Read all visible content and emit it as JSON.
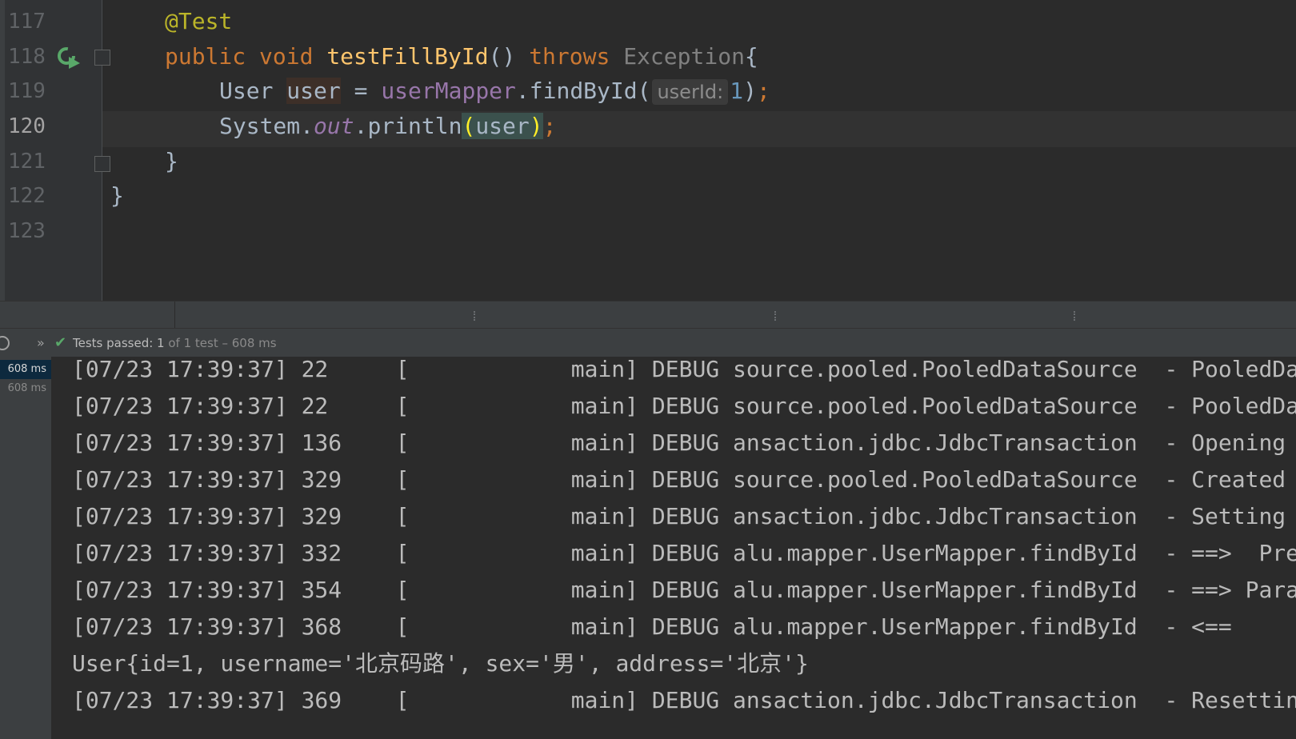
{
  "editor": {
    "line_numbers": [
      "117",
      "118",
      "119",
      "120",
      "121",
      "122",
      "123"
    ],
    "current_line": "120",
    "code": {
      "l117_annotation": "@Test",
      "l118_public": "public",
      "l118_void": "void",
      "l118_method": "testFillById",
      "l118_parens": "()",
      "l118_throws": "throws",
      "l118_exception": "Exception",
      "l118_brace": "{",
      "l119_type": "User",
      "l119_var": "user",
      "l119_eq": " = ",
      "l119_field": "userMapper",
      "l119_call": ".findById(",
      "l119_hint": "userId:",
      "l119_num": "1",
      "l119_close": ")",
      "l119_semi": ";",
      "l120_system": "System.",
      "l120_out": "out",
      "l120_println": ".println",
      "l120_open": "(",
      "l120_arg": "user",
      "l120_close": ")",
      "l120_semi": ";",
      "l121_brace": "}",
      "l122_brace": "}"
    }
  },
  "tests": {
    "status": "Tests passed: 1",
    "detail": " of 1 test – 608 ms",
    "tree_time_1": "608 ms",
    "tree_time_2": "608 ms"
  },
  "console": {
    "lines": [
      "[07/23 17:39:37] 22     [            main] DEBUG source.pooled.PooledDataSource  - PooledDa",
      "[07/23 17:39:37] 22     [            main] DEBUG source.pooled.PooledDataSource  - PooledDa",
      "[07/23 17:39:37] 136    [            main] DEBUG ansaction.jdbc.JdbcTransaction  - Opening",
      "[07/23 17:39:37] 329    [            main] DEBUG source.pooled.PooledDataSource  - Created",
      "[07/23 17:39:37] 329    [            main] DEBUG ansaction.jdbc.JdbcTransaction  - Setting",
      "[07/23 17:39:37] 332    [            main] DEBUG alu.mapper.UserMapper.findById  - ==>  Pre",
      "[07/23 17:39:37] 354    [            main] DEBUG alu.mapper.UserMapper.findById  - ==> Para",
      "[07/23 17:39:37] 368    [            main] DEBUG alu.mapper.UserMapper.findById  - <==",
      "User{id=1, username='北京码路', sex='男', address='北京'}",
      "[07/23 17:39:37] 369    [            main] DEBUG ansaction.jdbc.JdbcTransaction  - Resettin"
    ]
  },
  "icons": {
    "run": "run-test-icon",
    "fold": "fold-marker-icon",
    "passed": "check-icon",
    "expand": "chevron-double-right-icon",
    "history": "history-clock-icon"
  }
}
